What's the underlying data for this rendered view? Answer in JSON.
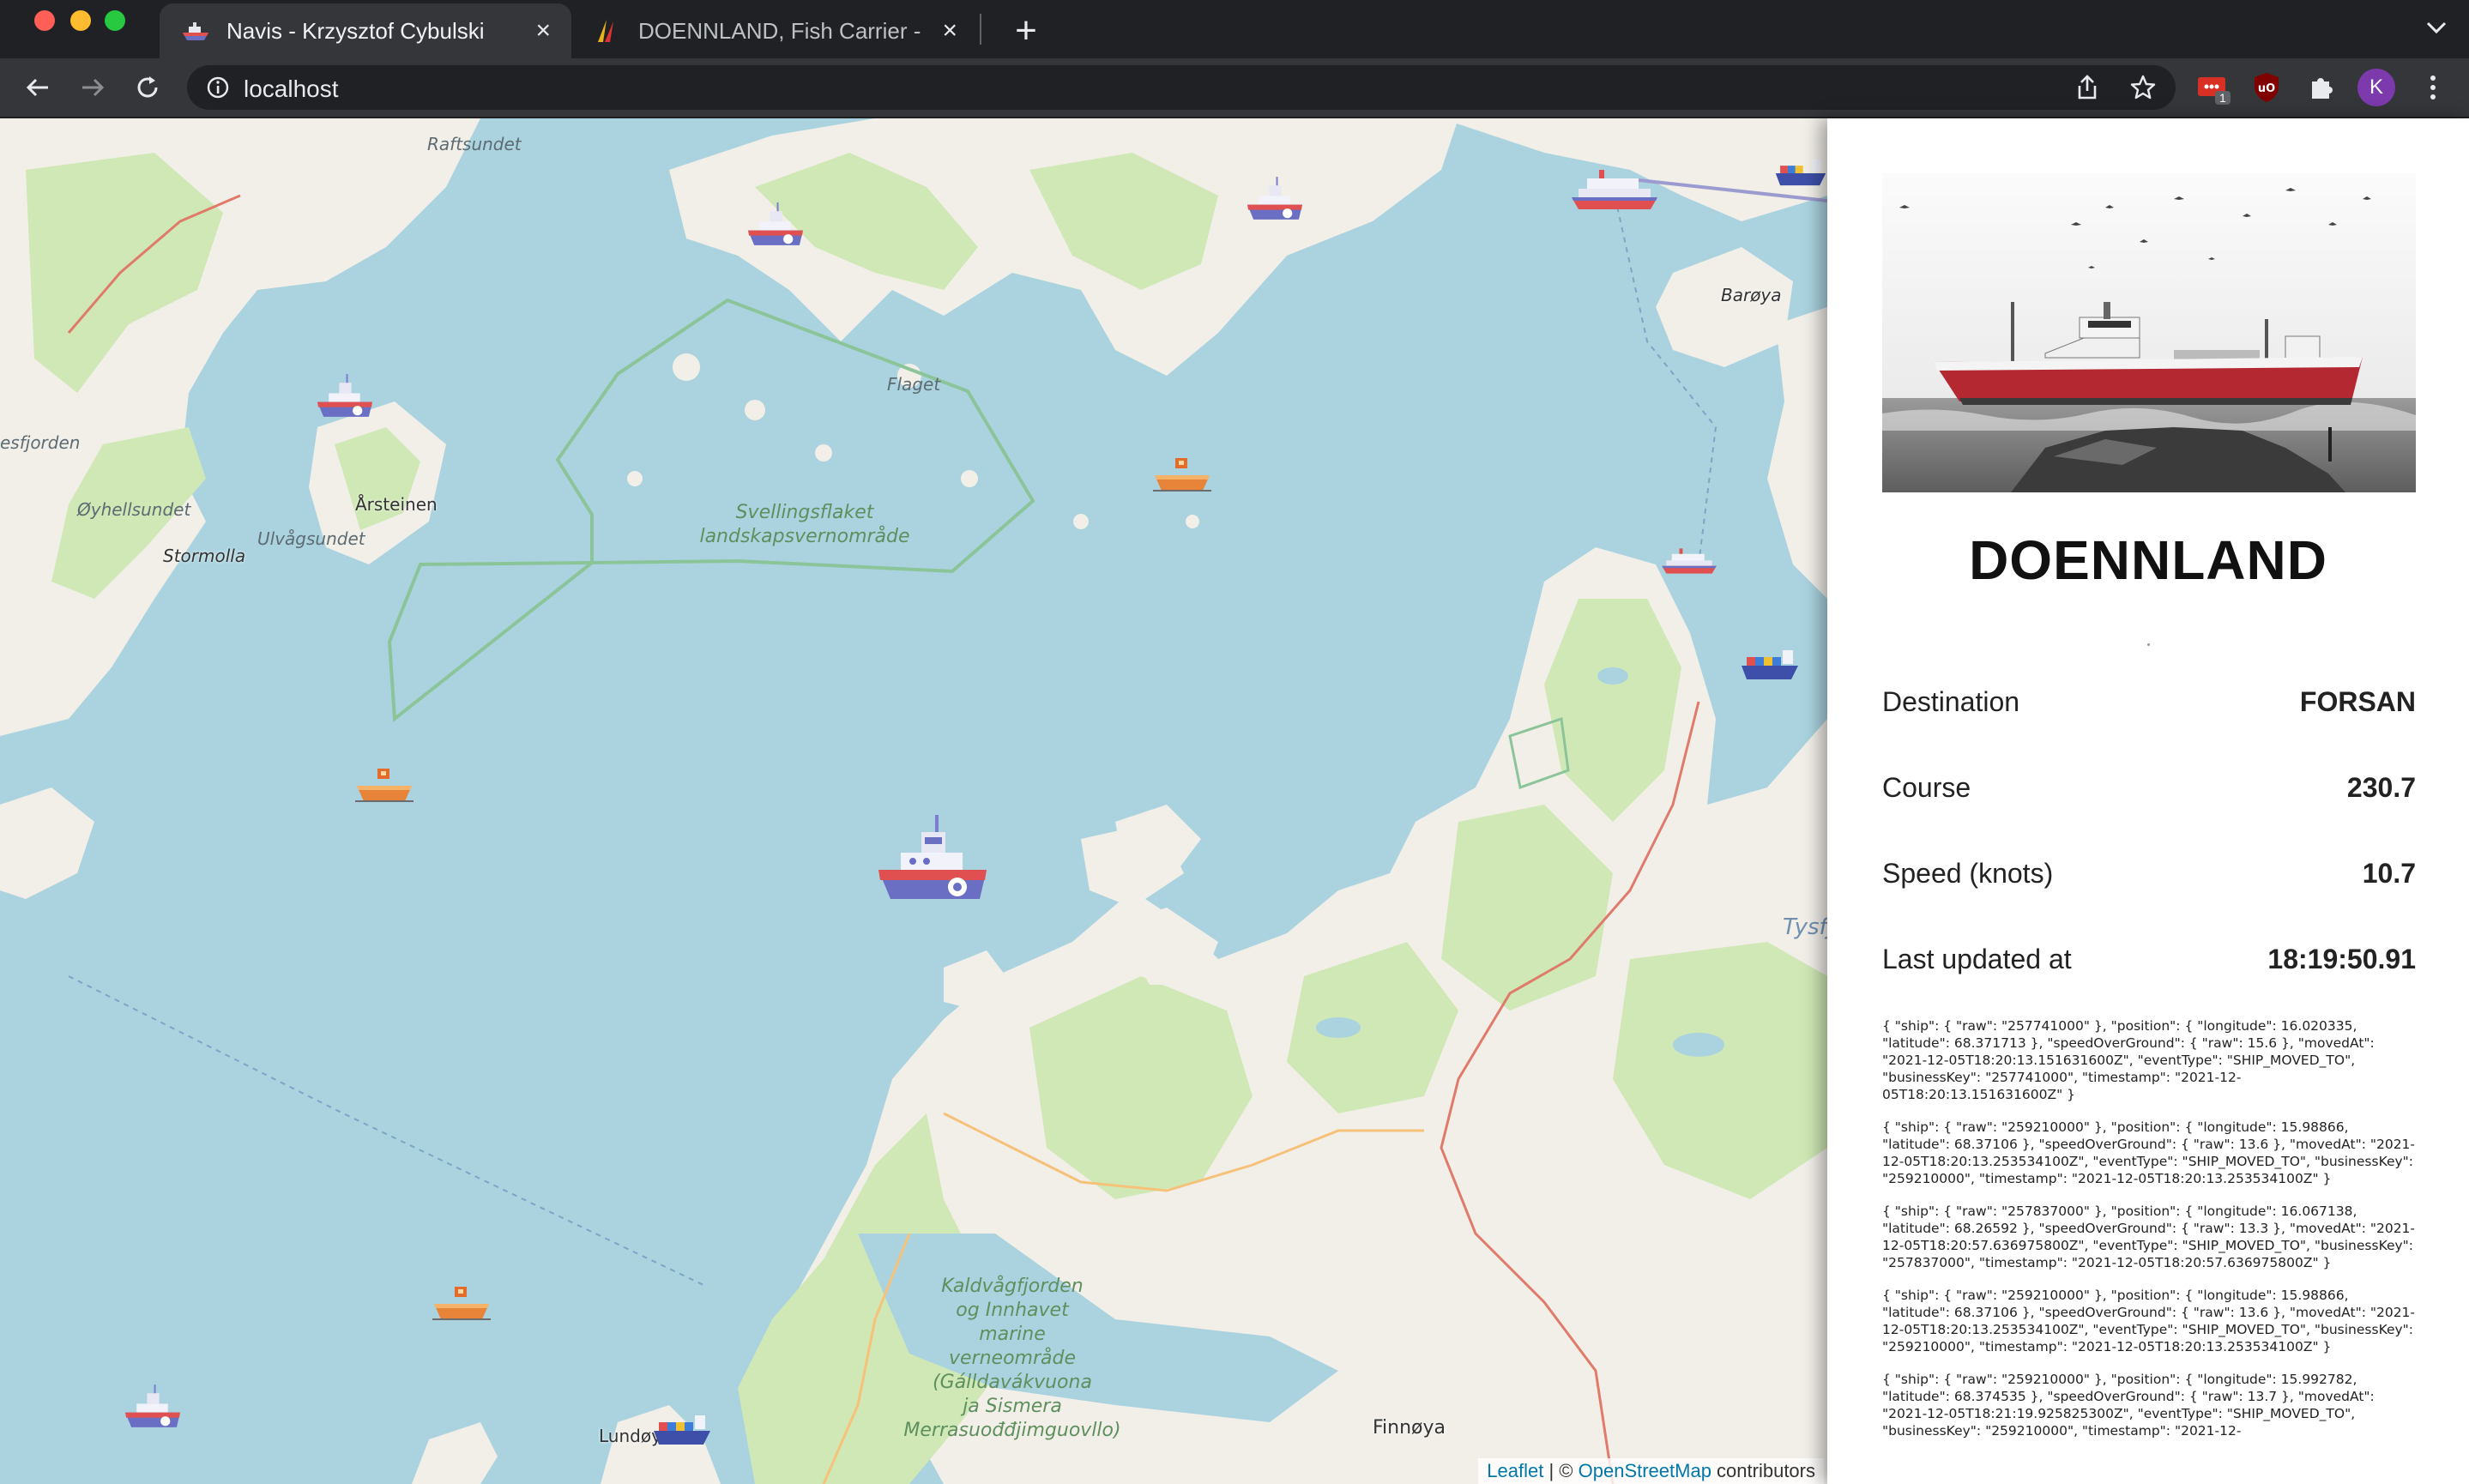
{
  "browser": {
    "tabs": [
      {
        "title": "Navis - Krzysztof Cybulski",
        "active": true
      },
      {
        "title": "DOENNLAND, Fish Carrier - Da",
        "active": false
      }
    ],
    "url": "localhost",
    "extension_badge": "1",
    "profile_initial": "K"
  },
  "map": {
    "labels": {
      "raftsundet": "Raftsundet",
      "baroya": "Barøya",
      "flaget": "Flaget",
      "esfjorden": "esfjorden",
      "oyhellsundet": "Øyhellsundet",
      "arsteinen": "Årsteinen",
      "ulvagsundet": "Ulvågsundet",
      "stormolla": "Stormolla",
      "tysfjord": "Tysfj",
      "lundoy": "Lundøy",
      "finnoya": "Finnøya",
      "svellingsflaket": "Svellingsflaket\nlandskapsvernområde",
      "kaldvag": "Kaldvågfjorden\nog Innhavet\nmarine\nverneområde\n(Gálldavákvuona\nja Sismera\nMerrasuođđjimguovllo)"
    },
    "attribution": {
      "leaflet": "Leaflet",
      "sep": " | © ",
      "osm": "OpenStreetMap",
      "suffix": " contributors"
    },
    "ship_icons": [
      "fishing-boat-icon",
      "tug-boat-icon",
      "ferry-icon",
      "cargo-ship-icon"
    ]
  },
  "panel": {
    "ship_name": "DOENNLAND",
    "rows": [
      {
        "label": "Destination",
        "value": "FORSAN"
      },
      {
        "label": "Course",
        "value": "230.7"
      },
      {
        "label": "Speed (knots)",
        "value": "10.7"
      },
      {
        "label": "Last updated at",
        "value": "18:19:50.91"
      }
    ],
    "events": [
      "{ \"ship\": { \"raw\": \"257741000\" }, \"position\": { \"longitude\": 16.020335, \"latitude\": 68.371713 }, \"speedOverGround\": { \"raw\": 15.6 }, \"movedAt\": \"2021-12-05T18:20:13.151631600Z\", \"eventType\": \"SHIP_MOVED_TO\", \"businessKey\": \"257741000\", \"timestamp\": \"2021-12-05T18:20:13.151631600Z\" }",
      "{ \"ship\": { \"raw\": \"259210000\" }, \"position\": { \"longitude\": 15.98866, \"latitude\": 68.37106 }, \"speedOverGround\": { \"raw\": 13.6 }, \"movedAt\": \"2021-12-05T18:20:13.253534100Z\", \"eventType\": \"SHIP_MOVED_TO\", \"businessKey\": \"259210000\", \"timestamp\": \"2021-12-05T18:20:13.253534100Z\" }",
      "{ \"ship\": { \"raw\": \"257837000\" }, \"position\": { \"longitude\": 16.067138, \"latitude\": 68.26592 }, \"speedOverGround\": { \"raw\": 13.3 }, \"movedAt\": \"2021-12-05T18:20:57.636975800Z\", \"eventType\": \"SHIP_MOVED_TO\", \"businessKey\": \"257837000\", \"timestamp\": \"2021-12-05T18:20:57.636975800Z\" }",
      "{ \"ship\": { \"raw\": \"259210000\" }, \"position\": { \"longitude\": 15.98866, \"latitude\": 68.37106 }, \"speedOverGround\": { \"raw\": 13.6 }, \"movedAt\": \"2021-12-05T18:20:13.253534100Z\", \"eventType\": \"SHIP_MOVED_TO\", \"businessKey\": \"259210000\", \"timestamp\": \"2021-12-05T18:20:13.253534100Z\" }",
      "{ \"ship\": { \"raw\": \"259210000\" }, \"position\": { \"longitude\": 15.992782, \"latitude\": 68.374535 }, \"speedOverGround\": { \"raw\": 13.7 }, \"movedAt\": \"2021-12-05T18:21:19.925825300Z\", \"eventType\": \"SHIP_MOVED_TO\", \"businessKey\": \"259210000\", \"timestamp\": \"2021-12-"
    ]
  },
  "colors": {
    "sea": "#aad3df",
    "land": "#f2efe9",
    "forest": "#cfe8b5",
    "protected_area": "#8cc49a",
    "road": "#e07a6a",
    "track": "#f6c27a",
    "hull_red": "#e05050",
    "hull_blue": "#5b5fb8"
  }
}
